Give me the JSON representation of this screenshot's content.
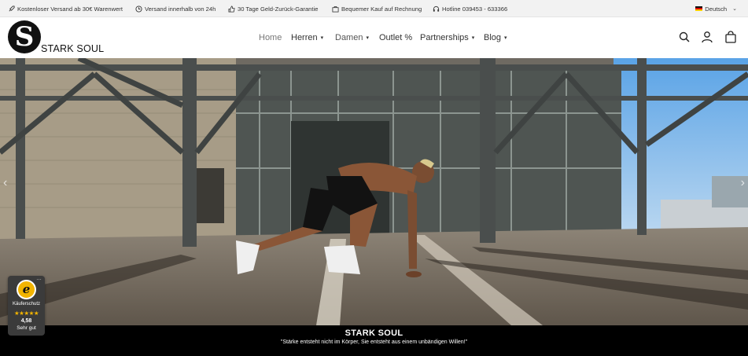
{
  "topbar": {
    "usps": [
      {
        "icon": "rocket-icon",
        "text": "Kostenloser Versand ab 30€ Warenwert"
      },
      {
        "icon": "clock-icon",
        "text": "Versand innerhalb von 24h"
      },
      {
        "icon": "thumbs-up-icon",
        "text": "30 Tage Geld-Zurück-Garantie"
      },
      {
        "icon": "briefcase-icon",
        "text": "Bequemer Kauf auf Rechnung"
      },
      {
        "icon": "headset-icon",
        "text": "Hotline 039453 - 633366"
      }
    ],
    "language": "Deutsch"
  },
  "header": {
    "logo_letter": "S",
    "logo_text": "STARK SOUL",
    "nav": [
      {
        "label": "Home",
        "dropdown": false
      },
      {
        "label": "Herren",
        "dropdown": true
      },
      {
        "label": "Damen",
        "dropdown": true
      },
      {
        "label": "Outlet %",
        "dropdown": false
      },
      {
        "label": "Partnerships",
        "dropdown": true
      },
      {
        "label": "Blog",
        "dropdown": true
      }
    ],
    "icons": [
      "search-icon",
      "account-icon",
      "cart-icon"
    ]
  },
  "hero": {
    "title": "STARK SOUL",
    "quote": "\"Stärke entsteht nicht im Körper, Sie entsteht aus einem unbändigen Willen!\""
  },
  "trust_badge": {
    "seal_letter": "e",
    "label": "Käuferschutz",
    "stars": "★★★★★",
    "score": "4,58",
    "rating_text": "Sehr gut"
  },
  "colors": {
    "accent": "#f2b400",
    "caption_bg": "#000000",
    "topbar_bg": "#f2f2f2"
  }
}
